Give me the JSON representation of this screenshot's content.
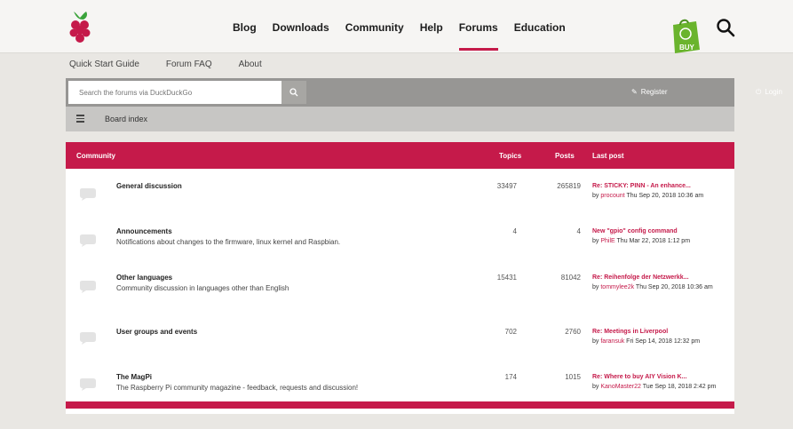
{
  "nav": {
    "items": [
      "Blog",
      "Downloads",
      "Community",
      "Help",
      "Forums",
      "Education"
    ],
    "active": "Forums",
    "buy_label": "BUY"
  },
  "subnav": [
    "Quick Start Guide",
    "Forum FAQ",
    "About"
  ],
  "search": {
    "placeholder": "Search the forums via DuckDuckGo",
    "register": "Register",
    "login": "Login"
  },
  "breadcrumb": "Board index",
  "panel": {
    "headers": {
      "name": "Community",
      "topics": "Topics",
      "posts": "Posts",
      "last": "Last post"
    },
    "rows": [
      {
        "title": "General discussion",
        "desc": "",
        "topics": "33497",
        "posts": "265819",
        "last_title": "Re: STICKY: PINN - An enhance...",
        "by": "by",
        "user": "procount",
        "date": "Thu Sep 20, 2018 10:36 am"
      },
      {
        "title": "Announcements",
        "desc": "Notifications about changes to the firmware, linux kernel and Raspbian.",
        "topics": "4",
        "posts": "4",
        "last_title": "New \"gpio\" config command",
        "by": "by",
        "user": "PhilE",
        "date": "Thu Mar 22, 2018 1:12 pm"
      },
      {
        "title": "Other languages",
        "desc": "Community discussion in languages other than English",
        "topics": "15431",
        "posts": "81042",
        "last_title": "Re: Reihenfolge der Netzwerkk...",
        "by": "by",
        "user": "tommylee2k",
        "date": "Thu Sep 20, 2018 10:36 am"
      },
      {
        "title": "User groups and events",
        "desc": "",
        "topics": "702",
        "posts": "2760",
        "last_title": "Re: Meetings in Liverpool",
        "by": "by",
        "user": "faransuk",
        "date": "Fri Sep 14, 2018 12:32 pm"
      },
      {
        "title": "The MagPi",
        "desc": "The Raspberry Pi community magazine - feedback, requests and discussion!",
        "topics": "174",
        "posts": "1015",
        "last_title": "Re: Where to buy AIY Vision K...",
        "by": "by",
        "user": "KanoMaster22",
        "date": "Tue Sep 18, 2018 2:42 pm"
      }
    ]
  },
  "colors": {
    "accent": "#c51a4a",
    "background": "#e9e7e3",
    "searchbar": "#979694",
    "breadcrumb_bar": "#c7c6c4"
  }
}
